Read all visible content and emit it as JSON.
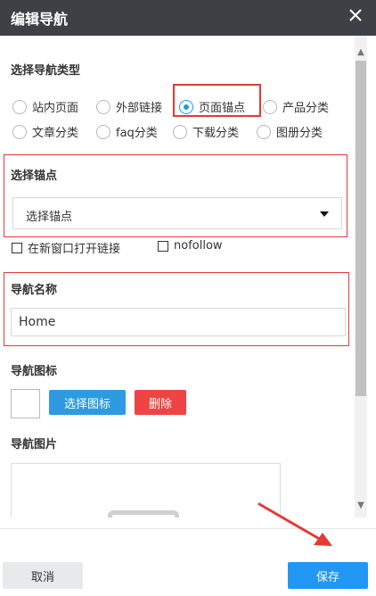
{
  "dialog": {
    "title": "编辑导航"
  },
  "nav_type": {
    "label": "选择导航类型",
    "options": [
      {
        "label": "站内页面",
        "selected": false
      },
      {
        "label": "外部链接",
        "selected": false
      },
      {
        "label": "页面锚点",
        "selected": true
      },
      {
        "label": "产品分类",
        "selected": false
      },
      {
        "label": "文章分类",
        "selected": false
      },
      {
        "label": "faq分类",
        "selected": false
      },
      {
        "label": "下载分类",
        "selected": false
      },
      {
        "label": "图册分类",
        "selected": false
      }
    ]
  },
  "anchor": {
    "label": "选择锚点",
    "selected_value": "选择锚点"
  },
  "options": {
    "new_window": {
      "label": "在新窗口打开链接",
      "checked": false
    },
    "nofollow": {
      "label": "nofollow",
      "checked": false
    }
  },
  "nav_name": {
    "label": "导航名称",
    "value": "Home"
  },
  "nav_icon": {
    "label": "导航图标",
    "select_button": "选择图标",
    "delete_button": "删除"
  },
  "nav_image": {
    "label": "导航图片"
  },
  "footer": {
    "cancel": "取消",
    "save": "保存"
  },
  "colors": {
    "titlebar": "#3d4045",
    "accent_blue": "#2196f3",
    "annotation_red": "#e53935",
    "delete_red": "#ef4444"
  }
}
